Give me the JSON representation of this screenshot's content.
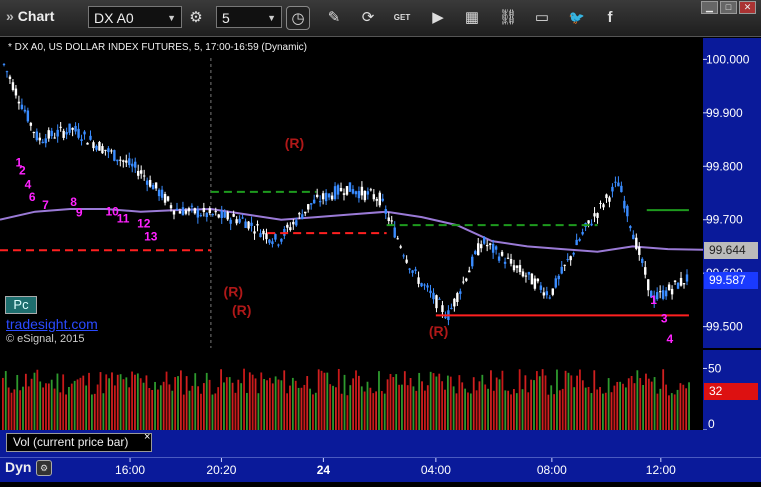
{
  "toolbar": {
    "title": "Chart",
    "symbol": "DX A0",
    "interval": "5",
    "buttons": [
      {
        "name": "settings-icon",
        "glyph": "⚙"
      },
      {
        "name": "clock-icon",
        "glyph": "◷"
      },
      {
        "name": "pencil-icon",
        "glyph": "✎"
      },
      {
        "name": "refresh-icon",
        "glyph": "⟳"
      },
      {
        "name": "get-icon",
        "glyph": "GET"
      },
      {
        "name": "play-icon",
        "glyph": "▶"
      },
      {
        "name": "calendar-icon",
        "glyph": "▦"
      },
      {
        "name": "link-icon",
        "glyph": "⛓"
      },
      {
        "name": "comment-icon",
        "glyph": "▭"
      },
      {
        "name": "twitter-icon",
        "glyph": "🐦"
      },
      {
        "name": "facebook-icon",
        "glyph": "f"
      }
    ]
  },
  "header_text": "* DX A0, US DOLLAR INDEX FUTURES, 5, 17:00-16:59 (Dynamic)",
  "badge": "Pc",
  "brand": "tradesight.com",
  "copyright": "© eSignal, 2015",
  "volume_panel_label": "Vol (current price bar)",
  "volume_close": "×",
  "dyn_label": "Dyn",
  "colors": {
    "up": "#3a8cff",
    "down": "#ffffff",
    "ma": "#9a7ad6",
    "red_level": "#ff2020",
    "green_level": "#1e9a1e",
    "magenta": "#ff22ff",
    "r_marker": "#b01818",
    "axis_bg": "#0a1a9a"
  },
  "chart_data": {
    "type": "line",
    "price_axis": {
      "ticks": [
        "100.000",
        "99.900",
        "99.800",
        "99.700",
        "99.600",
        "99.500"
      ],
      "range": [
        99.46,
        100.04
      ]
    },
    "time_axis": {
      "ticks": [
        "16:00",
        "20:20",
        "24",
        "04:00",
        "08:00",
        "12:00"
      ]
    },
    "last_price_label": "99.587",
    "last_price": 99.587,
    "ma_label": "99.644",
    "ma_value": 99.644,
    "price_series_x": [
      0,
      0.05,
      0.1,
      0.15,
      0.2,
      0.25,
      0.3,
      0.35,
      0.4,
      0.45,
      0.5,
      0.55,
      0.6,
      0.65,
      0.7,
      0.75,
      0.8,
      0.85,
      0.9,
      0.95,
      1
    ],
    "price_series": [
      99.99,
      99.85,
      99.87,
      99.83,
      99.79,
      99.72,
      99.71,
      99.7,
      99.66,
      99.73,
      99.76,
      99.74,
      99.6,
      99.52,
      99.66,
      99.61,
      99.56,
      99.68,
      99.77,
      99.55,
      99.59
    ],
    "ma_series": [
      99.7,
      99.715,
      99.72,
      99.72,
      99.715,
      99.718,
      99.72,
      99.71,
      99.7,
      99.705,
      99.71,
      99.715,
      99.705,
      99.69,
      99.66,
      99.65,
      99.645,
      99.64,
      99.65,
      99.645,
      99.644
    ],
    "levels": [
      {
        "kind": "red-dashed",
        "value": 99.643,
        "x_from": 0.0,
        "x_to": 0.3
      },
      {
        "kind": "red-dashed",
        "value": 99.675,
        "x_from": 0.38,
        "x_to": 0.55
      },
      {
        "kind": "green-dashed",
        "value": 99.752,
        "x_from": 0.3,
        "x_to": 0.45
      },
      {
        "kind": "green-dashed",
        "value": 99.69,
        "x_from": 0.55,
        "x_to": 0.85
      },
      {
        "kind": "red-solid",
        "value": 99.521,
        "x_from": 0.62,
        "x_to": 0.98
      },
      {
        "kind": "green-solid",
        "value": 99.718,
        "x_from": 0.92,
        "x_to": 0.98
      }
    ],
    "annotations": [
      {
        "text": "(R)",
        "x": 0.405,
        "y": 99.834,
        "color": "r_marker"
      },
      {
        "text": "(R)",
        "x": 0.318,
        "y": 99.556,
        "color": "r_marker"
      },
      {
        "text": "(R)",
        "x": 0.33,
        "y": 99.522,
        "color": "r_marker"
      },
      {
        "text": "(R)",
        "x": 0.61,
        "y": 99.482,
        "color": "r_marker"
      },
      {
        "text": "1",
        "x": 0.022,
        "y": 99.8,
        "color": "magenta"
      },
      {
        "text": "2",
        "x": 0.027,
        "y": 99.785,
        "color": "magenta"
      },
      {
        "text": "4",
        "x": 0.035,
        "y": 99.758,
        "color": "magenta"
      },
      {
        "text": "6",
        "x": 0.041,
        "y": 99.735,
        "color": "magenta"
      },
      {
        "text": "7",
        "x": 0.06,
        "y": 99.72,
        "color": "magenta"
      },
      {
        "text": "8",
        "x": 0.1,
        "y": 99.726,
        "color": "magenta"
      },
      {
        "text": "9",
        "x": 0.108,
        "y": 99.706,
        "color": "magenta"
      },
      {
        "text": "10",
        "x": 0.15,
        "y": 99.708,
        "color": "magenta"
      },
      {
        "text": "11",
        "x": 0.166,
        "y": 99.695,
        "color": "magenta"
      },
      {
        "text": "12",
        "x": 0.195,
        "y": 99.685,
        "color": "magenta"
      },
      {
        "text": "13",
        "x": 0.205,
        "y": 99.661,
        "color": "magenta"
      },
      {
        "text": "1",
        "x": 0.925,
        "y": 99.542,
        "color": "magenta"
      },
      {
        "text": "3",
        "x": 0.94,
        "y": 99.508,
        "color": "magenta"
      },
      {
        "text": "4",
        "x": 0.948,
        "y": 99.469,
        "color": "magenta"
      }
    ],
    "volume_axis": {
      "ticks": [
        "50",
        "32",
        "0"
      ],
      "range": [
        0,
        65
      ]
    },
    "volume_last_label": "32",
    "volume_last": 32
  }
}
